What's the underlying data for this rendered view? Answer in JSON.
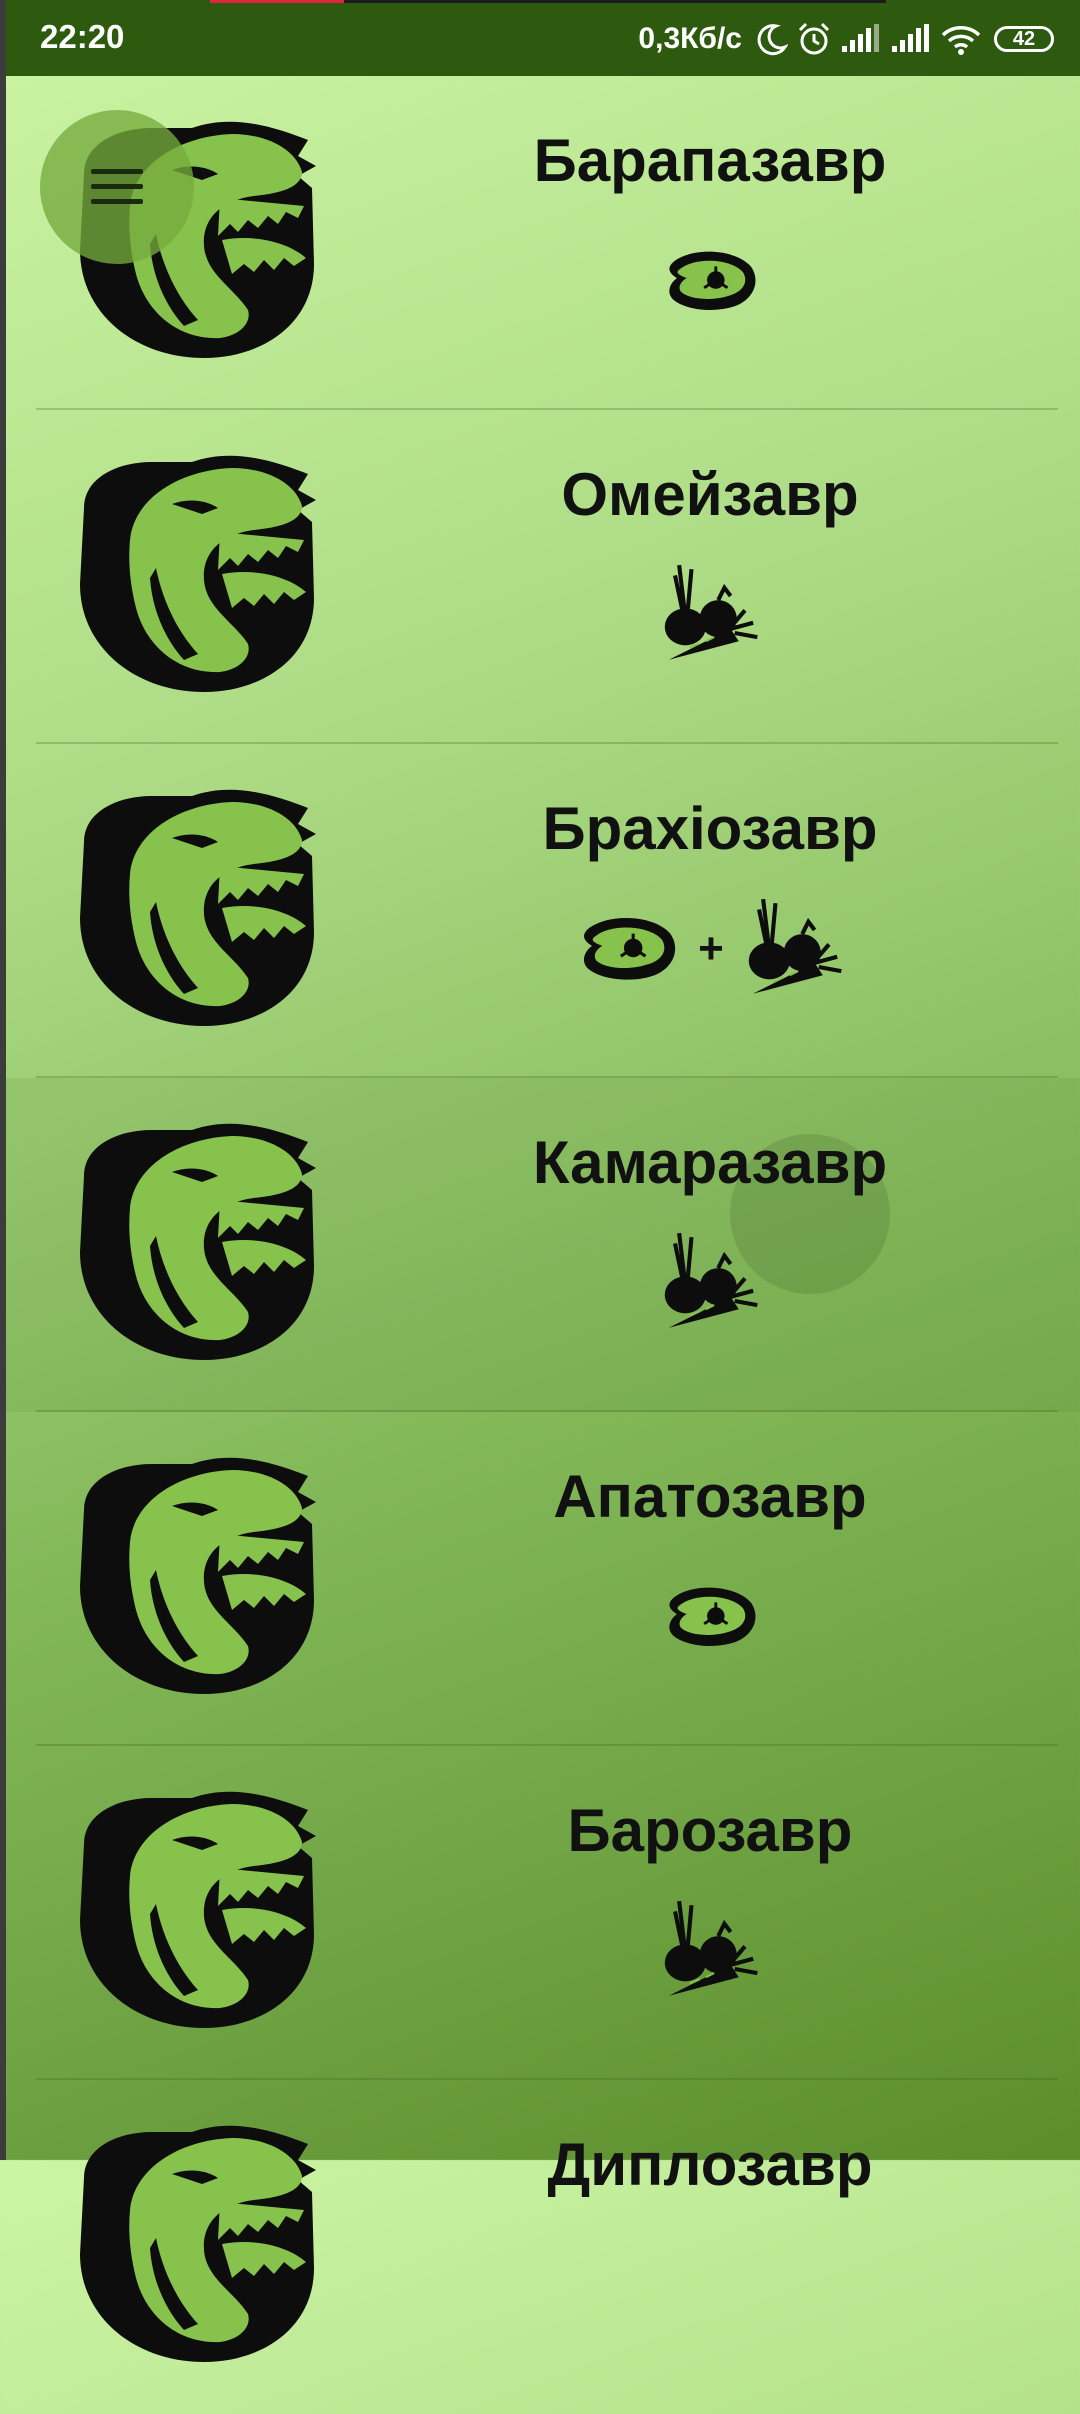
{
  "status_bar": {
    "time": "22:20",
    "network_speed": "0,3Кб/с",
    "battery": "42",
    "icons": [
      "moon-icon",
      "alarm-icon",
      "signal-icon",
      "signal-icon",
      "wifi-icon",
      "battery-icon"
    ]
  },
  "menu": {
    "icon": "hamburger-menu-icon"
  },
  "dinosaurs": [
    {
      "name": "Барапазавр",
      "diet": [
        "meat"
      ]
    },
    {
      "name": "Омейзавр",
      "diet": [
        "plants"
      ]
    },
    {
      "name": "Брахіозавр",
      "diet": [
        "meat",
        "plants"
      ],
      "separator": "+"
    },
    {
      "name": "Камаразавр",
      "diet": [
        "plants"
      ]
    },
    {
      "name": "Апатозавр",
      "diet": [
        "meat"
      ]
    },
    {
      "name": "Барозавр",
      "diet": [
        "plants"
      ]
    },
    {
      "name": "Диплозавр",
      "diet": []
    }
  ],
  "colors": {
    "status_bar": "#2e5a10",
    "background_top": "#ccf5a4",
    "background_bottom": "#5b8d2c",
    "emblem": "#0d0d0d",
    "emblem_face": "#86c24c",
    "menu_button": "#76aa3e"
  }
}
